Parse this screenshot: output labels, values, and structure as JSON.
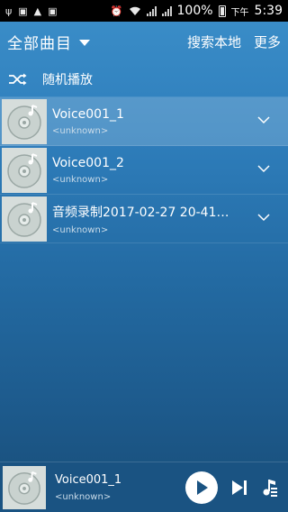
{
  "status_bar": {
    "battery": "100%",
    "ampm": "下午",
    "time": "5:39",
    "icons": [
      "usb-icon",
      "image-icon",
      "warning-icon",
      "alarm-icon",
      "wifi-icon",
      "signal-icon",
      "battery-icon"
    ]
  },
  "header": {
    "title": "全部曲目",
    "search_local": "搜索本地",
    "more": "更多"
  },
  "shuffle": {
    "label": "随机播放"
  },
  "tracks": [
    {
      "title": "Voice001_1",
      "artist": "<unknown>"
    },
    {
      "title": "Voice001_2",
      "artist": "<unknown>"
    },
    {
      "title": "音频录制2017-02-27 20-41…",
      "artist": "<unknown>"
    }
  ],
  "player": {
    "title": "Voice001_1",
    "artist": "<unknown>"
  },
  "colors": {
    "accent": "#2f7fbd",
    "player_bg": "#1a5382",
    "status_bar": "#000000"
  }
}
